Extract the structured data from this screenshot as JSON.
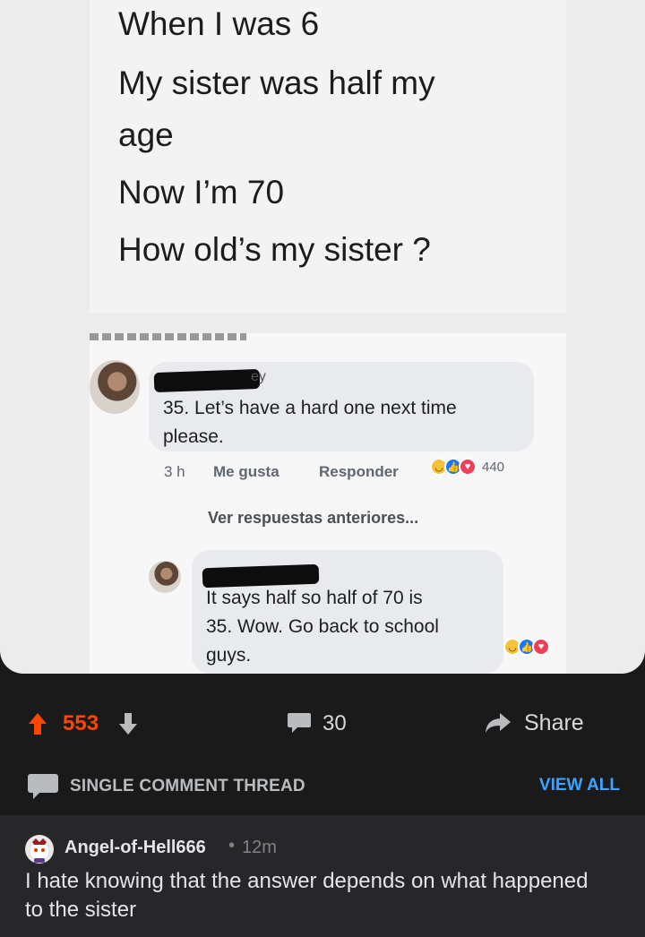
{
  "riddle": {
    "lines": [
      "When I was 6",
      "My sister was half my",
      "age",
      "Now I’m 70",
      "How old’s my sister ?"
    ]
  },
  "facebook": {
    "comment1": {
      "name_suffix": "ey",
      "text_line1": "35. Let’s have a hard one next time",
      "text_line2": "please.",
      "time": "3 h",
      "like": "Me gusta",
      "reply": "Responder",
      "reactions_count": "440"
    },
    "see_previous": "Ver respuestas anteriores...",
    "comment2": {
      "text_line1": "It says half so half of 70 is",
      "text_line2": "35. Wow. Go back to school",
      "text_line3": "guys."
    }
  },
  "action_bar": {
    "score": "553",
    "comments": "30",
    "share_label": "Share",
    "upvote_color": "#ff4500"
  },
  "thread": {
    "label": "SINGLE COMMENT THREAD",
    "view_all": "VIEW ALL",
    "link_color": "#3ca4ff"
  },
  "comment": {
    "author": "Angel-of-Hell666",
    "separator": "•",
    "time": "12m",
    "body": "I hate knowing that the answer depends on what happened to the sister"
  }
}
